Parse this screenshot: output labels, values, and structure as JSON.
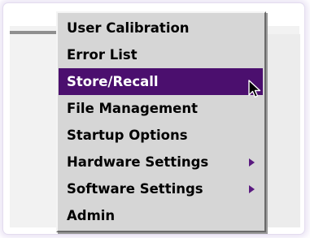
{
  "menu": {
    "items": [
      {
        "label": "User Calibration",
        "selected": false,
        "has_submenu": false
      },
      {
        "label": "Error List",
        "selected": false,
        "has_submenu": false
      },
      {
        "label": "Store/Recall",
        "selected": true,
        "has_submenu": false
      },
      {
        "label": "File Management",
        "selected": false,
        "has_submenu": false
      },
      {
        "label": "Startup Options",
        "selected": false,
        "has_submenu": false
      },
      {
        "label": "Hardware Settings",
        "selected": false,
        "has_submenu": true
      },
      {
        "label": "Software Settings",
        "selected": false,
        "has_submenu": true
      },
      {
        "label": "Admin",
        "selected": false,
        "has_submenu": false
      }
    ]
  },
  "colors": {
    "selected_background": "#4b0f6e",
    "selected_text": "#ffffff",
    "menu_background": "#d6d6d6",
    "submenu_arrow": "#5a1a80"
  },
  "icons": {
    "submenu": "submenu-arrow-icon",
    "pointer": "mouse-pointer-icon"
  }
}
